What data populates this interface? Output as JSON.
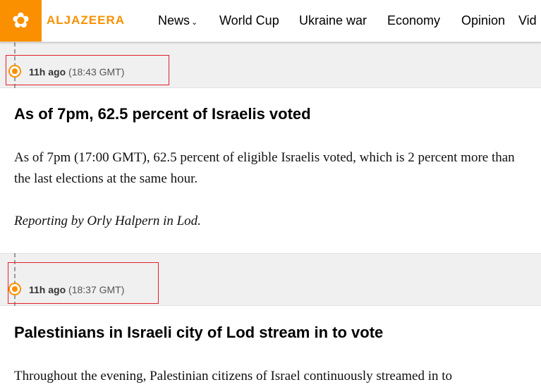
{
  "header": {
    "logo_icon": "aljazeera-calligraphy-logo",
    "brand": "ALJAZEERA",
    "nav": [
      "News",
      "World Cup",
      "Ukraine war",
      "Economy",
      "Opinion",
      "Vid"
    ]
  },
  "posts": [
    {
      "ago": "11h ago",
      "gmt": "(18:43 GMT)",
      "title": "As of 7pm, 62.5 percent of Israelis voted",
      "body": "As of 7pm (17:00 GMT), 62.5 percent of eligible Israelis voted, which is 2 percent more than the last elections at the same hour.",
      "credit": "Reporting by Orly Halpern in Lod."
    },
    {
      "ago": "11h ago",
      "gmt": "(18:37 GMT)",
      "title": "Palestinians in Israeli city of Lod stream in to vote",
      "body": "Throughout the evening, Palestinian citizens of Israel continuously streamed in to"
    }
  ],
  "colors": {
    "accent": "#fa9000",
    "highlight": "#e4202b"
  }
}
